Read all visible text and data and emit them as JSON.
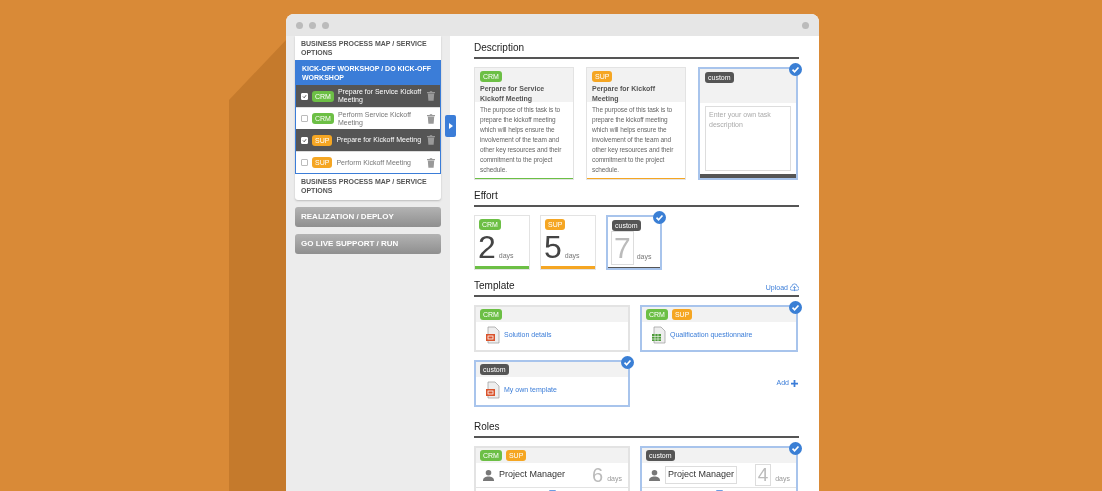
{
  "sidebar": {
    "sections": [
      {
        "title": "BUSINESS PROCESS MAP / SERVICE OPTIONS",
        "active": false
      },
      {
        "title": "KICK-OFF WORKSHOP / DO KICK-OFF WORKSHOP",
        "active": true,
        "tasks": [
          {
            "checked": true,
            "tag": {
              "label": "CRM",
              "kind": "crm"
            },
            "text": "Prepare for Service Kickoff Meeting"
          },
          {
            "checked": false,
            "tag": {
              "label": "CRM",
              "kind": "crm"
            },
            "text": "Perform Service Kickoff Meeting"
          },
          {
            "checked": true,
            "tag": {
              "label": "SUP",
              "kind": "sup"
            },
            "text": "Prepare for Kickoff Meeting"
          },
          {
            "checked": false,
            "tag": {
              "label": "SUP",
              "kind": "sup"
            },
            "text": "Perform Kickoff Meeting"
          }
        ]
      },
      {
        "title": "BUSINESS PROCESS MAP / SERVICE OPTIONS",
        "active": false
      }
    ],
    "phases": [
      "REALIZATION / DEPLOY",
      "GO LIVE SUPPORT / RUN"
    ]
  },
  "description": {
    "title": "Description",
    "cards": [
      {
        "kind": "preset",
        "selected": false,
        "tags": [
          {
            "label": "CRM",
            "kind": "crm"
          }
        ],
        "title": "Perpare for Service Kickoff Meeting",
        "body": "The purpose of this task is to prepare the kickoff meeting which will helps ensure the involvement of the team and other key resources and their commitment to the project schedule."
      },
      {
        "kind": "preset",
        "selected": false,
        "tags": [
          {
            "label": "SUP",
            "kind": "sup"
          }
        ],
        "title": "Perpare for Kickoff Meeting",
        "body": "The purpose of this task is to prepare the kickoff meeting which will helps ensure the involvement of the team and other key resources and their commitment to the project schedule."
      },
      {
        "kind": "custom",
        "selected": true,
        "tags": [
          {
            "label": "custom",
            "kind": "custom"
          }
        ],
        "placeholder": "Enter your own task description"
      }
    ]
  },
  "effort": {
    "title": "Effort",
    "cards": [
      {
        "kind": "preset",
        "selected": false,
        "tags": [
          {
            "label": "CRM",
            "kind": "crm"
          }
        ],
        "value": "2",
        "unit": "days"
      },
      {
        "kind": "preset",
        "selected": false,
        "tags": [
          {
            "label": "SUP",
            "kind": "sup"
          }
        ],
        "value": "5",
        "unit": "days"
      },
      {
        "kind": "custom",
        "selected": true,
        "tags": [
          {
            "label": "custom",
            "kind": "custom"
          }
        ],
        "placeholder": "7",
        "unit": "days"
      }
    ]
  },
  "template": {
    "title": "Template",
    "upload": "Upload",
    "add": "Add",
    "items": [
      {
        "kind": "presentation",
        "selected": false,
        "tags": [
          {
            "label": "CRM",
            "kind": "crm"
          }
        ],
        "name": "Solution details"
      },
      {
        "kind": "spreadsheet",
        "selected": true,
        "tags": [
          {
            "label": "CRM",
            "kind": "crm"
          },
          {
            "label": "SUP",
            "kind": "sup"
          }
        ],
        "name": "Qualification questionnaire"
      },
      {
        "kind": "presentation",
        "selected": true,
        "tags": [
          {
            "label": "custom",
            "kind": "custom"
          }
        ],
        "name": "My own template"
      }
    ]
  },
  "roles": {
    "title": "Roles",
    "cards": [
      {
        "kind": "preset",
        "selected": false,
        "tags": [
          {
            "label": "CRM",
            "kind": "crm"
          },
          {
            "label": "SUP",
            "kind": "sup"
          }
        ],
        "role": "Project Manager",
        "value": "6",
        "unit": "days"
      },
      {
        "kind": "custom",
        "selected": true,
        "tags": [
          {
            "label": "custom",
            "kind": "custom"
          }
        ],
        "role": "Project Manager",
        "placeholder": "4",
        "unit": "days"
      }
    ]
  }
}
